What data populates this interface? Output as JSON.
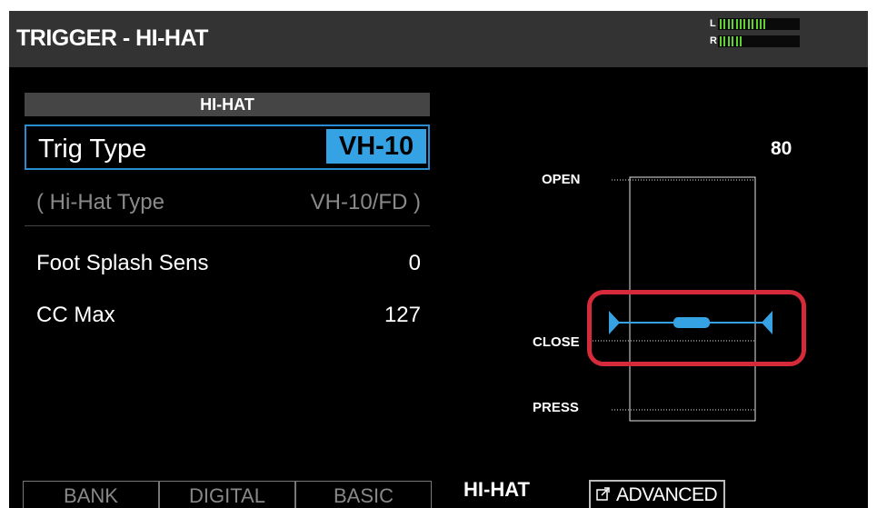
{
  "screen": {
    "title": "TRIGGER - HI-HAT",
    "meter": {
      "left_label": "L",
      "right_label": "R",
      "left_level": 0.6,
      "right_level": 0.3
    }
  },
  "panel": {
    "section_title": "HI-HAT",
    "trig_type": {
      "label": "Trig Type",
      "value": "VH-10"
    },
    "hihat_type": {
      "label": "( Hi-Hat Type",
      "value": "VH-10/FD )"
    },
    "params": [
      {
        "label": "Foot Splash Sens",
        "value": "0"
      },
      {
        "label": "CC Max",
        "value": "127"
      }
    ]
  },
  "diagram": {
    "open_label": "OPEN",
    "close_label": "CLOSE",
    "press_label": "PRESS",
    "max_value": "80"
  },
  "tabs": {
    "bank": "BANK",
    "digital": "DIGITAL",
    "basic": "BASIC",
    "hihat": "HI-HAT",
    "advanced": "ADVANCED"
  },
  "colors": {
    "accent_blue": "#35a3e3",
    "highlight_red": "#d52a39",
    "meter_green": "#5ed22e",
    "meter_yellow": "#e7e400"
  }
}
